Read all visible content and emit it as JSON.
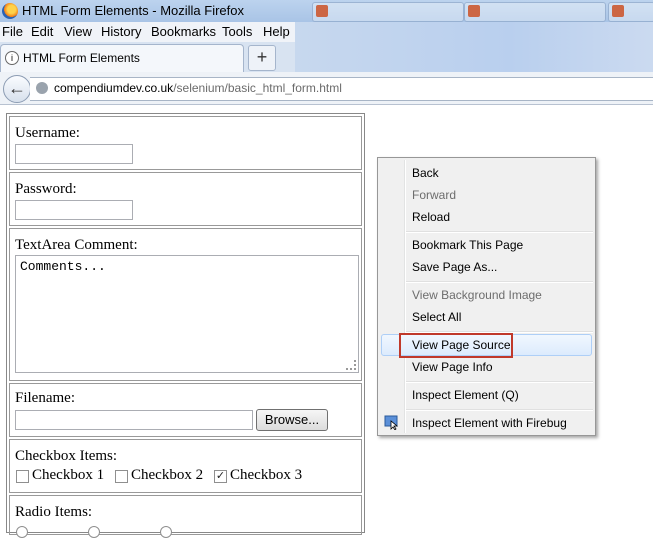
{
  "window": {
    "title": "HTML Form Elements - Mozilla Firefox"
  },
  "menubar": {
    "items": [
      "File",
      "Edit",
      "View",
      "History",
      "Bookmarks",
      "Tools",
      "Help"
    ]
  },
  "tab": {
    "label": "HTML Form Elements",
    "new_tab": "+"
  },
  "address": {
    "host": "compendiumdev.co.uk",
    "path": "/selenium/basic_html_form.html"
  },
  "form": {
    "username_label": "Username:",
    "password_label": "Password:",
    "textarea_label": "TextArea Comment:",
    "textarea_value": "Comments...",
    "filename_label": "Filename:",
    "browse_label": "Browse...",
    "checkbox_label": "Checkbox Items:",
    "checkboxes": [
      {
        "label": "Checkbox 1",
        "checked": false
      },
      {
        "label": "Checkbox 2",
        "checked": false
      },
      {
        "label": "Checkbox 3",
        "checked": true
      }
    ],
    "radio_label": "Radio Items:"
  },
  "context_menu": {
    "items": [
      {
        "label": "Back",
        "enabled": true
      },
      {
        "label": "Forward",
        "enabled": false
      },
      {
        "label": "Reload",
        "enabled": true
      },
      {
        "label": "Bookmark This Page",
        "enabled": true
      },
      {
        "label": "Save Page As...",
        "enabled": true
      },
      {
        "label": "View Background Image",
        "enabled": false
      },
      {
        "label": "Select All",
        "enabled": true
      },
      {
        "label": "View Page Source",
        "enabled": true,
        "highlighted": true
      },
      {
        "label": "View Page Info",
        "enabled": true
      },
      {
        "label": "Inspect Element (Q)",
        "enabled": true
      },
      {
        "label": "Inspect Element with Firebug",
        "enabled": true,
        "icon": "firebug-icon"
      }
    ]
  },
  "colors": {
    "highlight_box": "#c0392b",
    "menu_bg": "#f0f0f0"
  }
}
